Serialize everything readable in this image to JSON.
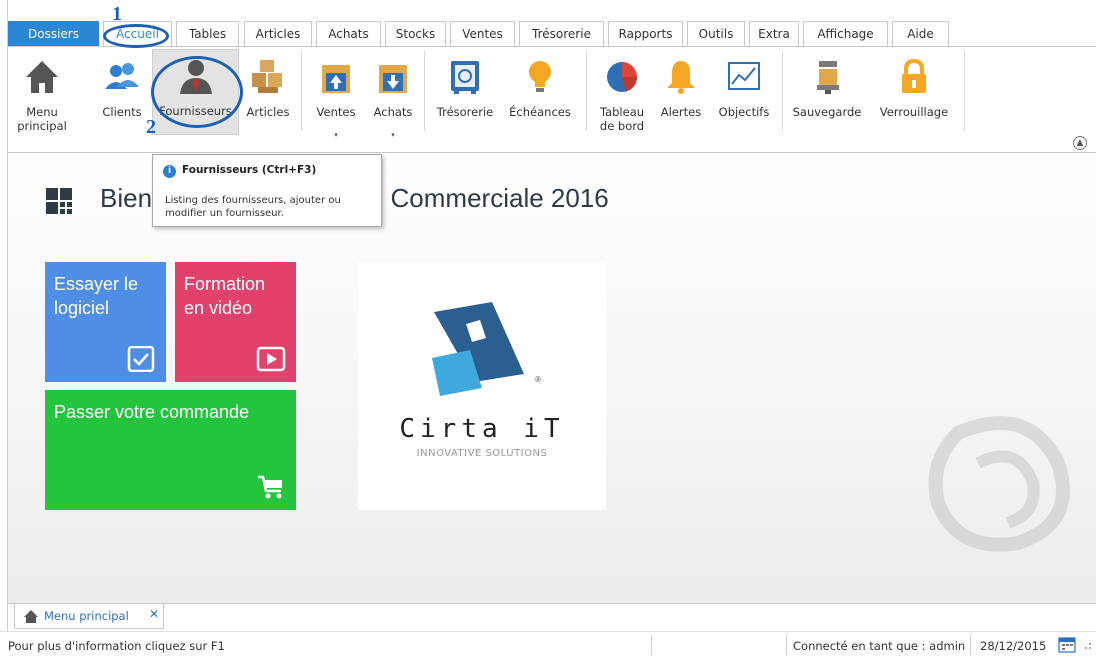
{
  "ribbon_tabs": [
    "Dossiers",
    "Accueil",
    "Tables",
    "Articles",
    "Achats",
    "Stocks",
    "Ventes",
    "Trésorerie",
    "Rapports",
    "Outils",
    "Extra",
    "Affichage",
    "Aide"
  ],
  "ribbon_buttons": {
    "menu": "Menu\nprincipal",
    "clients": "Clients",
    "fournisseurs": "Fournisseurs",
    "articles": "Articles",
    "ventes": "Ventes",
    "achats": "Achats",
    "tresorerie": "Trésorerie",
    "echeances": "Échéances",
    "tableau": "Tableau\nde bord",
    "alertes": "Alertes",
    "objectifs": "Objectifs",
    "sauvegarde": "Sauvegarde",
    "verrouillage": "Verrouillage"
  },
  "dropdown_arrow": "▾",
  "collapse_glyph": "▲",
  "annotations": {
    "one": "1",
    "two": "2"
  },
  "tooltip": {
    "title": "Fournisseurs (Ctrl+F3)",
    "body": "Listing des fournisseurs, ajouter ou modifier un fournisseur.",
    "info_glyph": "i"
  },
  "welcome": "Bienvenue dans Gestion Commerciale 2016",
  "tiles": {
    "try": "Essayer le\nlogiciel",
    "video": "Formation\nen vidéo",
    "order": "Passer votre commande"
  },
  "logo": {
    "name": "Cirta iT",
    "tagline": "INNOVATIVE SOLUTIONS",
    "reg": "®"
  },
  "doc_tab": {
    "label": "Menu principal",
    "close": "✕"
  },
  "status": {
    "help": "Pour plus d'information cliquez sur F1",
    "user": "Connecté en tant que : admin",
    "date": "28/12/2015"
  },
  "colors": {
    "accent": "#2b87d3",
    "tile_try": "#4f8ee6",
    "tile_video": "#e1416a",
    "tile_order": "#22c53b",
    "annotation": "#1d5fb3"
  }
}
